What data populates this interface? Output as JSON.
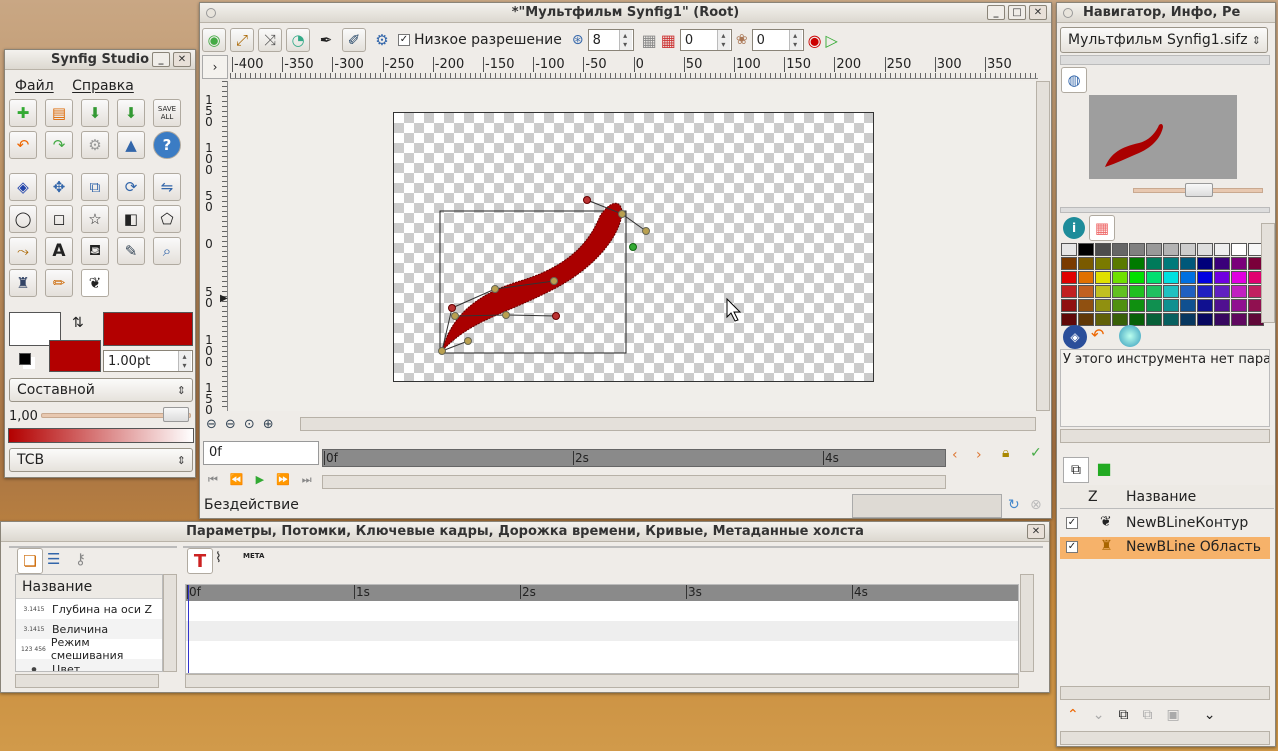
{
  "toolbox": {
    "title": "Synfig Studio",
    "menu": [
      "Файл",
      "Справка"
    ],
    "save_all": "SAVE ALL",
    "outline_color": "#ffffff",
    "fill_color": "#b30000",
    "width_value": "1.00pt",
    "blend_method": "Составной",
    "opacity_value": "1,00",
    "interpolation": "TCB"
  },
  "canvas": {
    "title": "*\"Мультфильм Synfig1\" (Root)",
    "low_res_label": "Низкое разрешение",
    "low_res_checked": true,
    "pixel_size": "8",
    "grid_value_1": "0",
    "grid_value_2": "0",
    "ruler_ticks": [
      "-400",
      "-350",
      "-300",
      "-250",
      "-200",
      "-150",
      "-100",
      "-50",
      "0",
      "50",
      "100",
      "150",
      "200",
      "250",
      "300",
      "350"
    ],
    "vruler_labels": [
      "1 5 0",
      "1 0 0",
      "5 0",
      "0",
      "5 0",
      "1 0 0",
      "1 5 0"
    ],
    "time_field": "0f",
    "time_ticks": [
      "0f",
      "2s",
      "4s"
    ],
    "status": "Бездействие"
  },
  "navigator": {
    "title": "Навигатор, Инфо, Ре",
    "file_select": "Мультфильм Synfig1.sifz",
    "tool_options_text": "У этого инструмента нет пара",
    "layers_header": {
      "z": "Z",
      "name": "Название"
    },
    "layers": [
      {
        "name": "NewBLineКонтур",
        "checked": true,
        "selected": false
      },
      {
        "name": "NewBLine Область",
        "checked": true,
        "selected": true
      }
    ],
    "palette": [
      "#e6e6e6",
      "#000000",
      "#4d4d4d",
      "#666666",
      "#808080",
      "#999999",
      "#b3b3b3",
      "#cccccc",
      "#dddddd",
      "#eeeeee",
      "#ffffff",
      "#f7f7f7",
      "#7a3a00",
      "#7a5a00",
      "#7a7a00",
      "#5a7a00",
      "#007a00",
      "#007a5a",
      "#007a7a",
      "#00587a",
      "#00007a",
      "#3a007a",
      "#7a007a",
      "#7a003a",
      "#e00000",
      "#e07000",
      "#e0e000",
      "#70e000",
      "#00e000",
      "#00e070",
      "#00e0e0",
      "#0070e0",
      "#0000e0",
      "#7000e0",
      "#e000e0",
      "#e00070",
      "#c02020",
      "#c06020",
      "#c0c020",
      "#60c020",
      "#20c020",
      "#20c060",
      "#20c0c0",
      "#2060c0",
      "#2020c0",
      "#6020c0",
      "#c020c0",
      "#c02060",
      "#901010",
      "#905010",
      "#909010",
      "#509010",
      "#109010",
      "#109050",
      "#109090",
      "#105090",
      "#101090",
      "#501090",
      "#901090",
      "#901050",
      "#600808",
      "#603808",
      "#606008",
      "#386008",
      "#086008",
      "#086038",
      "#086060",
      "#083860",
      "#080860",
      "#380860",
      "#600860",
      "#600838"
    ]
  },
  "params": {
    "title": "Параметры, Потомки, Ключевые кадры, Дорожка времени, Кривые, Метаданные холста",
    "column_name": "Название",
    "rows": [
      {
        "icon": "3.1415",
        "label": "Глубина на оси Z"
      },
      {
        "icon": "3.1415",
        "label": "Величина"
      },
      {
        "icon": "123 456",
        "label": "Режим смешивания"
      },
      {
        "icon": "●",
        "label": "Цвет"
      }
    ],
    "meta_label": "META",
    "time_ticks": [
      "0f",
      "1s",
      "2s",
      "3s",
      "4s"
    ]
  }
}
